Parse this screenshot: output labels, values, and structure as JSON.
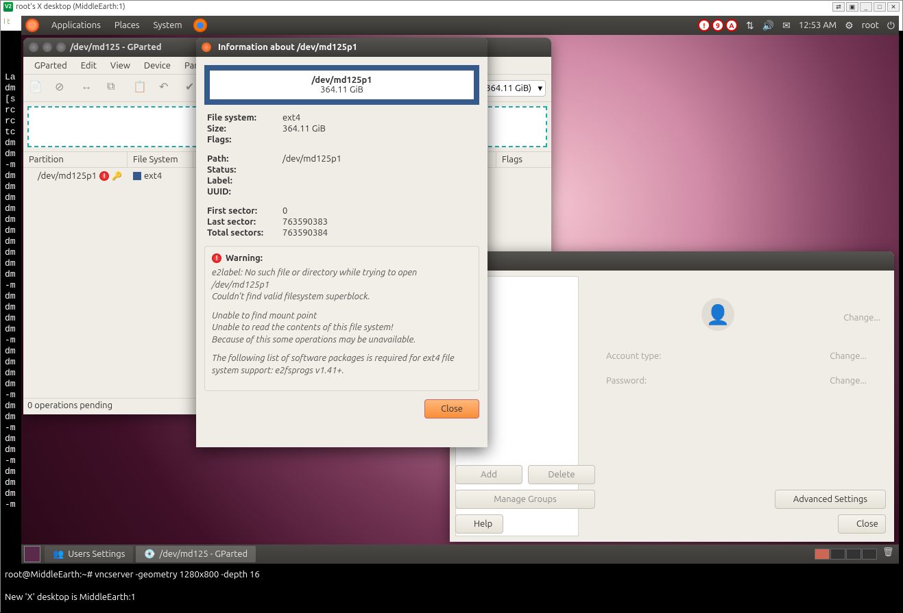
{
  "vnc": {
    "title": "root's X desktop (MiddleEarth:1)"
  },
  "browser_strip": "I t",
  "panel": {
    "menus": [
      "Applications",
      "Places",
      "System"
    ],
    "indicators": [
      "!",
      "9",
      "A"
    ],
    "time": "12:53 AM",
    "user": "root"
  },
  "gparted": {
    "title": "/dev/md125 - GParted",
    "menus": [
      "GParted",
      "Edit",
      "View",
      "Device",
      "Partition"
    ],
    "device": "364.11 GiB)",
    "headers": {
      "partition": "Partition",
      "fs": "File System",
      "flags": "Flags"
    },
    "row": {
      "name": "/dev/md125p1",
      "fs": "ext4"
    },
    "status": "0 operations pending"
  },
  "info": {
    "title": "Information about /dev/md125p1",
    "box_name": "/dev/md125p1",
    "box_size": "364.11 GiB",
    "labels": {
      "fs": "File system:",
      "size": "Size:",
      "flags": "Flags:",
      "path": "Path:",
      "status": "Status:",
      "label": "Label:",
      "uuid": "UUID:",
      "first": "First sector:",
      "last": "Last sector:",
      "total": "Total sectors:"
    },
    "values": {
      "fs": "ext4",
      "size": "364.11 GiB",
      "path": "/dev/md125p1",
      "first": "0",
      "last": "763590383",
      "total": "763590384"
    },
    "warning_label": "Warning:",
    "warning": {
      "p1": "e2label: No such file or directory while trying to open /dev/md125p1",
      "p2": "Couldn't find valid filesystem superblock.",
      "p3": "Unable to find mount point",
      "p4": "Unable to read the contents of this file system!",
      "p5": "Because of this some operations may be unavailable.",
      "p6": "The following list of software packages is required for ext4 file system support:  e2fsprogs v1.41+."
    },
    "close": "Close"
  },
  "users": {
    "fields": {
      "account": "Account type:",
      "password": "Password:"
    },
    "change": "Change...",
    "add": "Add",
    "delete": "Delete",
    "manage": "Manage Groups",
    "help": "Help",
    "advanced": "Advanced Settings",
    "close": "Close"
  },
  "taskbar": {
    "t1": "Users Settings",
    "t2": "/dev/md125 - GParted"
  },
  "terminal": {
    "line1": "root@MiddleEarth:~# vncserver -geometry 1280x800 -depth 16",
    "line2": "New 'X' desktop is MiddleEarth:1"
  },
  "terminal_bg": "La\ndm\n[s\nrc\nrc\ntc\ndm\ndm\n-m\ndm\ndm\ndm\ndm\ndm\ndm\ndm\ndm\ndm\ndm\n-m\ndm\ndm\ndm\ndm\n-m\ndm\ndm\ndm\ndm\n-m\ndm\ndm\n-m\ndm\ndm\n-m\ndm\ndm\ndm\n-m"
}
